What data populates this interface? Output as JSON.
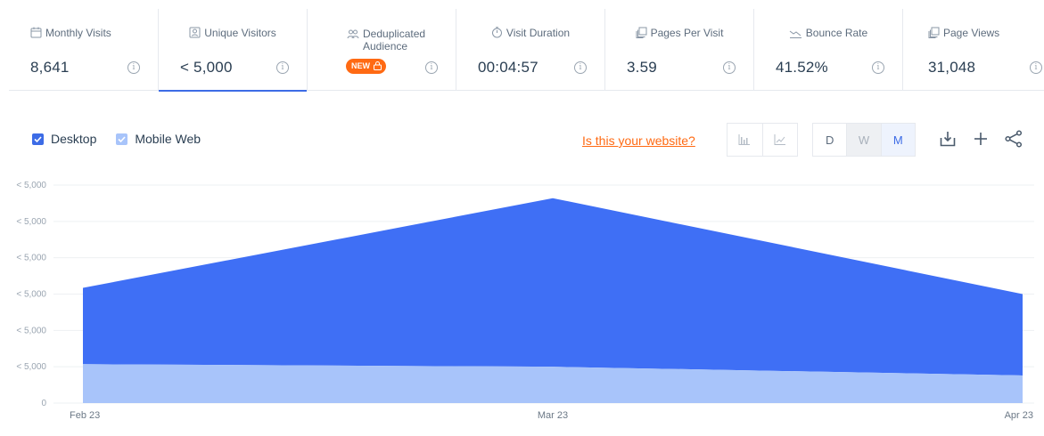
{
  "metrics": [
    {
      "label": "Monthly Visits",
      "value": "8,641",
      "icon": "calendar-icon"
    },
    {
      "label": "Unique Visitors",
      "value": "< 5,000",
      "icon": "user-card-icon",
      "active": true
    },
    {
      "label": "Deduplicated Audience",
      "badge": "NEW",
      "icon": "people-icon"
    },
    {
      "label": "Visit Duration",
      "value": "00:04:57",
      "icon": "stopwatch-icon"
    },
    {
      "label": "Pages Per Visit",
      "value": "3.59",
      "icon": "pages-icon"
    },
    {
      "label": "Bounce Rate",
      "value": "41.52%",
      "icon": "trend-down-icon"
    },
    {
      "label": "Page Views",
      "value": "31,048",
      "icon": "pages-icon"
    }
  ],
  "info_glyph": "i",
  "legend": {
    "desktop": "Desktop",
    "mobile": "Mobile Web"
  },
  "own_site_link": "Is this your website?",
  "granularity": {
    "day": "D",
    "week": "W",
    "month": "M"
  },
  "colors": {
    "desktop": "#3f6ff5",
    "mobile": "#a8c4fa",
    "accent": "#3d6ce6",
    "orange": "#ff6a13"
  },
  "chart_data": {
    "type": "area",
    "stacked": true,
    "categories": [
      "Feb 23",
      "Mar 23",
      "Apr 23"
    ],
    "y_tick_labels": [
      "0",
      "< 5,000",
      "< 5,000",
      "< 5,000",
      "< 5,000",
      "< 5,000",
      "< 5,000"
    ],
    "y_ticks": [
      0,
      1000,
      2000,
      3000,
      4000,
      5000,
      6000
    ],
    "ylim": [
      0,
      6000
    ],
    "grid": true,
    "series": [
      {
        "name": "Mobile Web",
        "values": [
          1070,
          1000,
          760
        ]
      },
      {
        "name": "Desktop",
        "values": [
          2100,
          4640,
          2240
        ]
      }
    ]
  }
}
